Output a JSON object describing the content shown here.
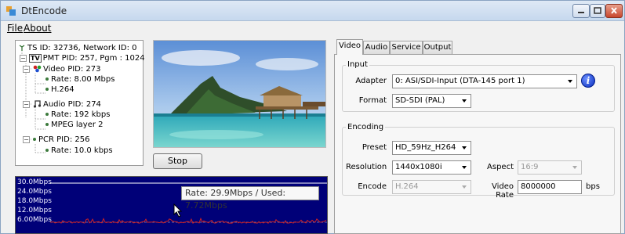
{
  "window": {
    "title": "DtEncode"
  },
  "menu": {
    "file": "File",
    "about": "About"
  },
  "tree": {
    "ts": "TS ID: 32736, Network ID: 0",
    "pmt": "PMT PID: 257, Pgm : 1024",
    "pmt_badge": "TV",
    "video": "Video PID: 273",
    "video_rate": "Rate: 8.00 Mbps",
    "video_codec": "H.264",
    "audio": "Audio PID: 274",
    "audio_rate": "Rate: 192 kbps",
    "audio_codec": "MPEG layer 2",
    "pcr": "PCR PID: 256",
    "pcr_rate": "Rate: 10.0 kbps"
  },
  "stop_label": "Stop",
  "graph": {
    "y_labels": [
      "30.0Mbps",
      "24.0Mbps",
      "18.0Mbps",
      "12.0Mbps",
      "6.00Mbps"
    ],
    "tooltip": "Rate: 29.9Mbps / Used: 7.72Mbps",
    "line_color": "#d02020"
  },
  "tabs": [
    "Video",
    "Audio",
    "Service",
    "Output"
  ],
  "active_tab": "Video",
  "input": {
    "title": "Input",
    "adapter_label": "Adapter",
    "adapter_value": "0: ASI/SDI-Input (DTA-145 port 1)",
    "format_label": "Format",
    "format_value": "SD-SDI (PAL)"
  },
  "encoding": {
    "title": "Encoding",
    "preset_label": "Preset",
    "preset_value": "HD_59Hz_H264",
    "resolution_label": "Resolution",
    "resolution_value": "1440x1080i",
    "aspect_label": "Aspect",
    "aspect_value": "16:9",
    "encode_label": "Encode",
    "encode_value": "H.264",
    "video_rate_label": "Video Rate",
    "video_rate_value": "8000000",
    "video_rate_unit": "bps"
  },
  "icons": {
    "info": "info-icon",
    "app": "app-icon"
  }
}
